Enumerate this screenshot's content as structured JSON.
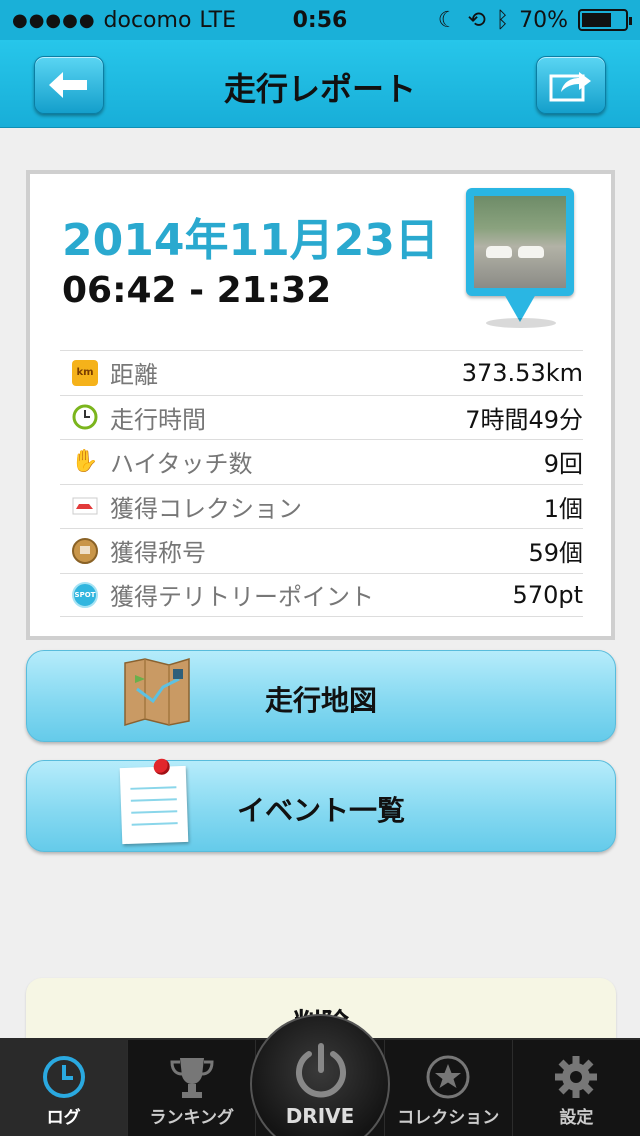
{
  "status_bar": {
    "carrier": "docomo",
    "network": "LTE",
    "time": "0:56",
    "battery": "70%"
  },
  "nav": {
    "title": "走行レポート",
    "back_icon": "arrow-left-icon",
    "share_icon": "share-arrow-icon"
  },
  "report": {
    "date": "2014年11月23日",
    "time_range": "06:42 - 21:32",
    "stats": [
      {
        "icon": "km-icon",
        "label": "距離",
        "value": "373.53km"
      },
      {
        "icon": "clock-icon",
        "label": "走行時間",
        "value": "7時間49分"
      },
      {
        "icon": "hand-icon",
        "label": "ハイタッチ数",
        "value": "9回"
      },
      {
        "icon": "car-icon",
        "label": "獲得コレクション",
        "value": "1個"
      },
      {
        "icon": "medal-icon",
        "label": "獲得称号",
        "value": "59個"
      },
      {
        "icon": "spot-icon",
        "label": "獲得テリトリーポイント",
        "value": "570pt"
      }
    ]
  },
  "actions": {
    "map_label": "走行地図",
    "events_label": "イベント一覧",
    "delete_label": "削除"
  },
  "tabs": [
    {
      "label": "ログ",
      "icon": "clock-icon",
      "active": true
    },
    {
      "label": "ランキング",
      "icon": "trophy-icon",
      "active": false
    },
    {
      "label": "DRIVE",
      "icon": "power-icon",
      "active": false
    },
    {
      "label": "コレクション",
      "icon": "star-icon",
      "active": false
    },
    {
      "label": "設定",
      "icon": "gear-icon",
      "active": false
    }
  ],
  "colors": {
    "accent": "#1ab0d8",
    "date_text": "#2aa9cf",
    "button_light": "#b6ecfb"
  }
}
